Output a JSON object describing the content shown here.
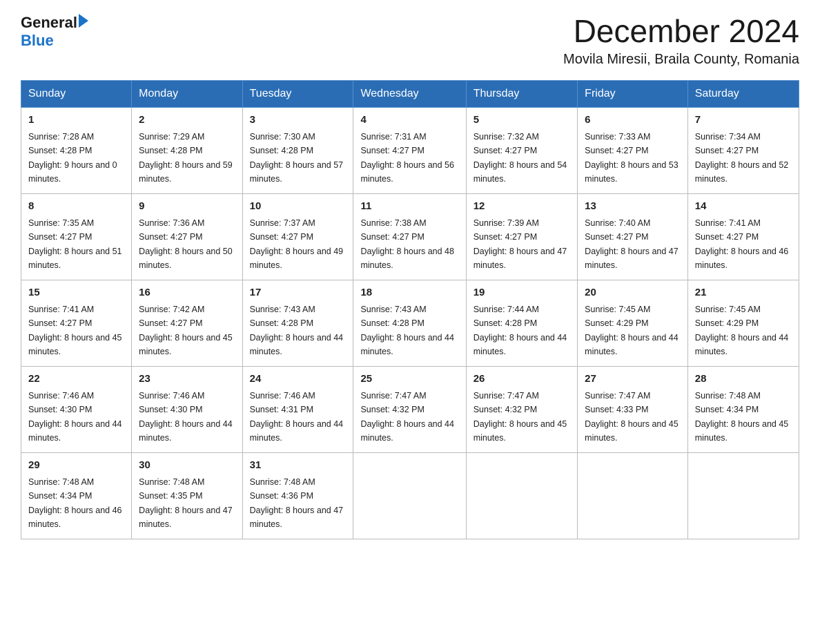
{
  "header": {
    "logo_general": "General",
    "logo_blue": "Blue",
    "month_title": "December 2024",
    "location": "Movila Miresii, Braila County, Romania"
  },
  "days_of_week": [
    "Sunday",
    "Monday",
    "Tuesday",
    "Wednesday",
    "Thursday",
    "Friday",
    "Saturday"
  ],
  "weeks": [
    [
      {
        "day": "1",
        "sunrise": "Sunrise: 7:28 AM",
        "sunset": "Sunset: 4:28 PM",
        "daylight": "Daylight: 9 hours and 0 minutes."
      },
      {
        "day": "2",
        "sunrise": "Sunrise: 7:29 AM",
        "sunset": "Sunset: 4:28 PM",
        "daylight": "Daylight: 8 hours and 59 minutes."
      },
      {
        "day": "3",
        "sunrise": "Sunrise: 7:30 AM",
        "sunset": "Sunset: 4:28 PM",
        "daylight": "Daylight: 8 hours and 57 minutes."
      },
      {
        "day": "4",
        "sunrise": "Sunrise: 7:31 AM",
        "sunset": "Sunset: 4:27 PM",
        "daylight": "Daylight: 8 hours and 56 minutes."
      },
      {
        "day": "5",
        "sunrise": "Sunrise: 7:32 AM",
        "sunset": "Sunset: 4:27 PM",
        "daylight": "Daylight: 8 hours and 54 minutes."
      },
      {
        "day": "6",
        "sunrise": "Sunrise: 7:33 AM",
        "sunset": "Sunset: 4:27 PM",
        "daylight": "Daylight: 8 hours and 53 minutes."
      },
      {
        "day": "7",
        "sunrise": "Sunrise: 7:34 AM",
        "sunset": "Sunset: 4:27 PM",
        "daylight": "Daylight: 8 hours and 52 minutes."
      }
    ],
    [
      {
        "day": "8",
        "sunrise": "Sunrise: 7:35 AM",
        "sunset": "Sunset: 4:27 PM",
        "daylight": "Daylight: 8 hours and 51 minutes."
      },
      {
        "day": "9",
        "sunrise": "Sunrise: 7:36 AM",
        "sunset": "Sunset: 4:27 PM",
        "daylight": "Daylight: 8 hours and 50 minutes."
      },
      {
        "day": "10",
        "sunrise": "Sunrise: 7:37 AM",
        "sunset": "Sunset: 4:27 PM",
        "daylight": "Daylight: 8 hours and 49 minutes."
      },
      {
        "day": "11",
        "sunrise": "Sunrise: 7:38 AM",
        "sunset": "Sunset: 4:27 PM",
        "daylight": "Daylight: 8 hours and 48 minutes."
      },
      {
        "day": "12",
        "sunrise": "Sunrise: 7:39 AM",
        "sunset": "Sunset: 4:27 PM",
        "daylight": "Daylight: 8 hours and 47 minutes."
      },
      {
        "day": "13",
        "sunrise": "Sunrise: 7:40 AM",
        "sunset": "Sunset: 4:27 PM",
        "daylight": "Daylight: 8 hours and 47 minutes."
      },
      {
        "day": "14",
        "sunrise": "Sunrise: 7:41 AM",
        "sunset": "Sunset: 4:27 PM",
        "daylight": "Daylight: 8 hours and 46 minutes."
      }
    ],
    [
      {
        "day": "15",
        "sunrise": "Sunrise: 7:41 AM",
        "sunset": "Sunset: 4:27 PM",
        "daylight": "Daylight: 8 hours and 45 minutes."
      },
      {
        "day": "16",
        "sunrise": "Sunrise: 7:42 AM",
        "sunset": "Sunset: 4:27 PM",
        "daylight": "Daylight: 8 hours and 45 minutes."
      },
      {
        "day": "17",
        "sunrise": "Sunrise: 7:43 AM",
        "sunset": "Sunset: 4:28 PM",
        "daylight": "Daylight: 8 hours and 44 minutes."
      },
      {
        "day": "18",
        "sunrise": "Sunrise: 7:43 AM",
        "sunset": "Sunset: 4:28 PM",
        "daylight": "Daylight: 8 hours and 44 minutes."
      },
      {
        "day": "19",
        "sunrise": "Sunrise: 7:44 AM",
        "sunset": "Sunset: 4:28 PM",
        "daylight": "Daylight: 8 hours and 44 minutes."
      },
      {
        "day": "20",
        "sunrise": "Sunrise: 7:45 AM",
        "sunset": "Sunset: 4:29 PM",
        "daylight": "Daylight: 8 hours and 44 minutes."
      },
      {
        "day": "21",
        "sunrise": "Sunrise: 7:45 AM",
        "sunset": "Sunset: 4:29 PM",
        "daylight": "Daylight: 8 hours and 44 minutes."
      }
    ],
    [
      {
        "day": "22",
        "sunrise": "Sunrise: 7:46 AM",
        "sunset": "Sunset: 4:30 PM",
        "daylight": "Daylight: 8 hours and 44 minutes."
      },
      {
        "day": "23",
        "sunrise": "Sunrise: 7:46 AM",
        "sunset": "Sunset: 4:30 PM",
        "daylight": "Daylight: 8 hours and 44 minutes."
      },
      {
        "day": "24",
        "sunrise": "Sunrise: 7:46 AM",
        "sunset": "Sunset: 4:31 PM",
        "daylight": "Daylight: 8 hours and 44 minutes."
      },
      {
        "day": "25",
        "sunrise": "Sunrise: 7:47 AM",
        "sunset": "Sunset: 4:32 PM",
        "daylight": "Daylight: 8 hours and 44 minutes."
      },
      {
        "day": "26",
        "sunrise": "Sunrise: 7:47 AM",
        "sunset": "Sunset: 4:32 PM",
        "daylight": "Daylight: 8 hours and 45 minutes."
      },
      {
        "day": "27",
        "sunrise": "Sunrise: 7:47 AM",
        "sunset": "Sunset: 4:33 PM",
        "daylight": "Daylight: 8 hours and 45 minutes."
      },
      {
        "day": "28",
        "sunrise": "Sunrise: 7:48 AM",
        "sunset": "Sunset: 4:34 PM",
        "daylight": "Daylight: 8 hours and 45 minutes."
      }
    ],
    [
      {
        "day": "29",
        "sunrise": "Sunrise: 7:48 AM",
        "sunset": "Sunset: 4:34 PM",
        "daylight": "Daylight: 8 hours and 46 minutes."
      },
      {
        "day": "30",
        "sunrise": "Sunrise: 7:48 AM",
        "sunset": "Sunset: 4:35 PM",
        "daylight": "Daylight: 8 hours and 47 minutes."
      },
      {
        "day": "31",
        "sunrise": "Sunrise: 7:48 AM",
        "sunset": "Sunset: 4:36 PM",
        "daylight": "Daylight: 8 hours and 47 minutes."
      },
      null,
      null,
      null,
      null
    ]
  ]
}
